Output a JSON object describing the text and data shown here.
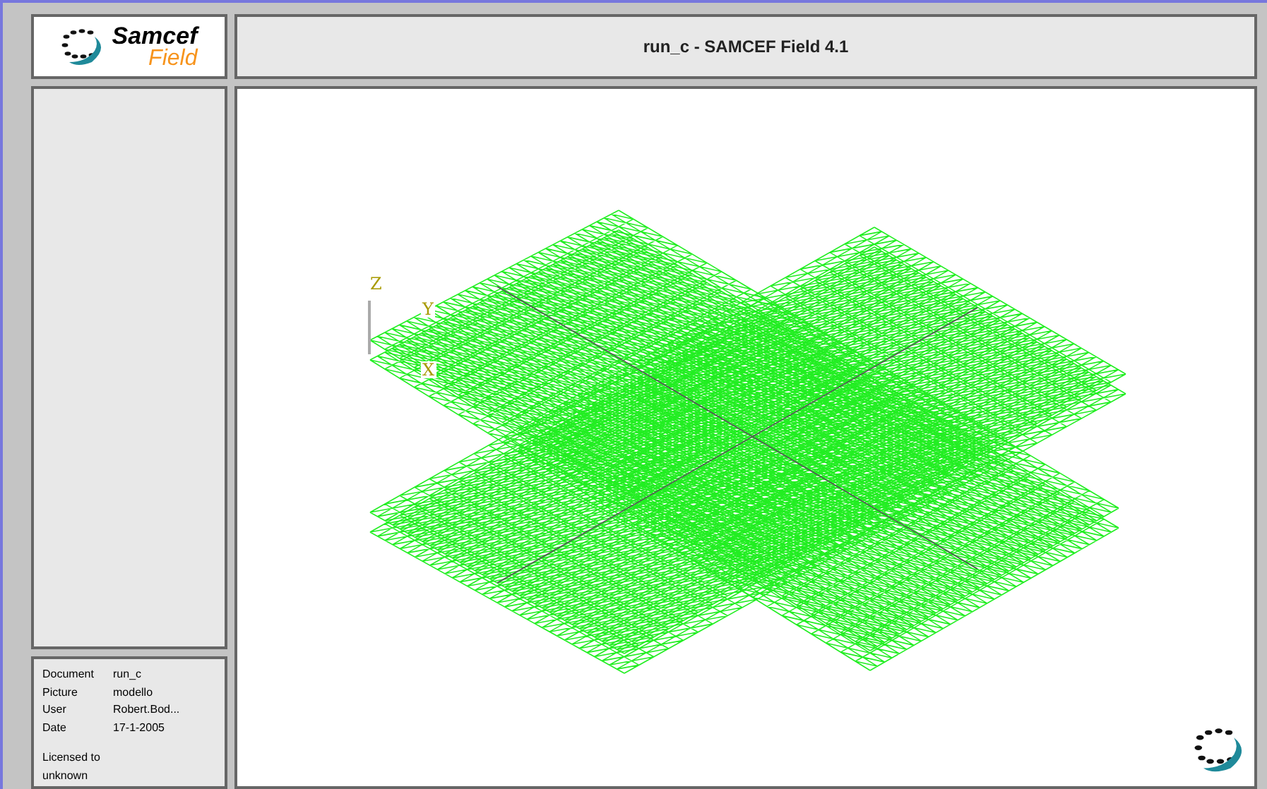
{
  "logo": {
    "line_1": "Samcef",
    "line_2": "Field"
  },
  "window": {
    "title": "run_c - SAMCEF Field 4.1"
  },
  "viewport": {
    "axes": [
      {
        "label": "Z"
      },
      {
        "label": "Y"
      },
      {
        "label": "X"
      }
    ]
  },
  "info": {
    "rows": [
      {
        "label": "Document",
        "value": "run_c"
      },
      {
        "label": "Picture",
        "value": "modello"
      },
      {
        "label": "User",
        "value": "Robert.Bod..."
      },
      {
        "label": "Date",
        "value": "17-1-2005"
      }
    ],
    "license": [
      "Licensed to",
      "unknown"
    ]
  }
}
